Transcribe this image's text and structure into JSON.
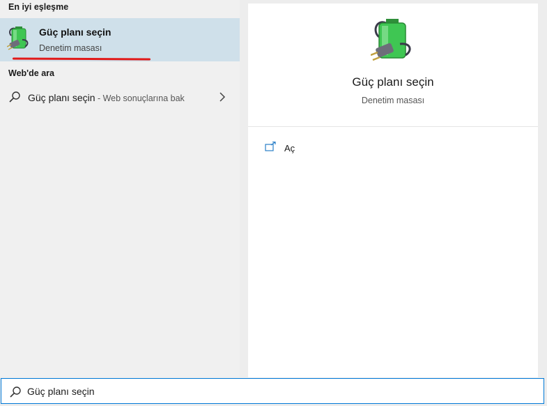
{
  "left": {
    "best_match_header": "En iyi eşleşme",
    "best_match": {
      "title": "Güç planı seçin",
      "subtitle": "Denetim masası"
    },
    "web_header": "Web'de ara",
    "web_result": {
      "query": "Güç planı seçin",
      "suffix": " - Web sonuçlarına bak"
    }
  },
  "right": {
    "title": "Güç planı seçin",
    "subtitle": "Denetim masası",
    "actions": [
      {
        "label": "Aç",
        "icon": "open-window-icon"
      }
    ]
  },
  "search": {
    "value": "Güç planı seçin"
  },
  "colors": {
    "selection": "#cfe0ea",
    "annotation": "#e11a1a",
    "battery": "#37c24a",
    "focus": "#0078d7"
  }
}
